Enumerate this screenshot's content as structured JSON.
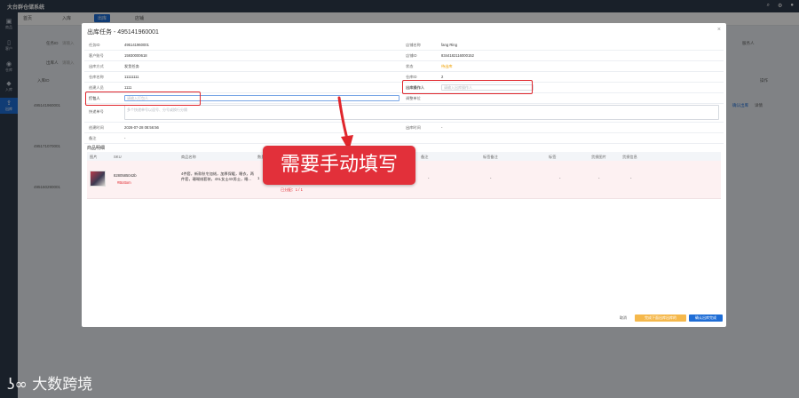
{
  "app": {
    "title": "大台群仓储系统"
  },
  "topbar": {
    "icons": [
      "search-icon",
      "gear-icon",
      "user-icon"
    ]
  },
  "sidebar": {
    "items": [
      {
        "label": "商品"
      },
      {
        "label": "客户"
      },
      {
        "label": "仓库"
      },
      {
        "label": "入库"
      },
      {
        "label": "出库"
      }
    ]
  },
  "tabs": [
    {
      "label": "首页"
    },
    {
      "label": "入库"
    },
    {
      "label": "出库"
    },
    {
      "label": "店铺"
    }
  ],
  "background": {
    "filter1_label": "任务ID",
    "filter1_placeholder": "请输入",
    "filter2_label": "出库人",
    "filter2_placeholder": "请输入",
    "filter3_label": "服务人",
    "col1": "入库ID",
    "col_op": "操作",
    "rows": [
      {
        "id": "495141960001",
        "action1": "确认出库",
        "action2": "详情"
      },
      {
        "id": "495171070001"
      },
      {
        "id": "495160290001"
      }
    ]
  },
  "modal": {
    "title": "出库任务 - 495141960001",
    "fields": {
      "task_id_label": "任务ID",
      "task_id": "495141960001",
      "store_name_label": "店铺名称",
      "store_name": "fang Ring",
      "account_label": "客户账号",
      "account": "15930000618",
      "store_id_label": "店铺ID",
      "store_id": "8344182116000152",
      "method_label": "出库方式",
      "method": "发货任务",
      "status_label": "状态",
      "status": "待出库",
      "warehouse_label": "仓库名称",
      "warehouse": "11111111",
      "warehouse_no_label": "仓库ID",
      "warehouse_no": "2",
      "creator_label": "创建人员",
      "creator": "1111",
      "operator_label": "出库操作人",
      "operator_placeholder": "请输入出库操作人",
      "packer_label": "打包人",
      "packer_placeholder": "请输入打包人",
      "fee_label": "调整单位",
      "tracking_label": "快递单号",
      "tracking_placeholder": "多个快递单号以逗号、分号或换行分隔",
      "created_label": "创建时间",
      "created": "2026-07-28 08:56:56",
      "out_time_label": "出库时间",
      "out_time": "-",
      "note_label": "备注",
      "note": "-"
    },
    "items_section": "商品明细",
    "item_headers": [
      "图片",
      "SKU",
      "商品名称",
      "数量",
      "存储位置",
      "备注",
      "标签备注",
      "标签",
      "货损图片",
      "货损信息"
    ],
    "storage_link": "多码默认分配",
    "item": {
      "sku": "8280585042b",
      "sku_tag": "#Bottom",
      "name": "4件套，新款秋冬加绒，加厚保暖，睡衣，两件套，珊瑚绒套装，4XL女士4X男士，睡...",
      "qty": "1",
      "loc1": "入库单：495141020001",
      "loc2": "SKU：82805850428",
      "loc3": "货架：",
      "loc4": "数量：1",
      "loc_status": "已分配：1 / 1",
      "remark": "-",
      "tag_remark": "-",
      "tag": "-",
      "dmg_img": "-",
      "dmg_info": "-"
    },
    "buttons": {
      "cancel": "取消",
      "yellow": "完成下面出库出库的",
      "confirm": "确认出库完成"
    }
  },
  "callout": {
    "text": "需要手动填写"
  },
  "watermark": {
    "text": "大数跨境"
  }
}
